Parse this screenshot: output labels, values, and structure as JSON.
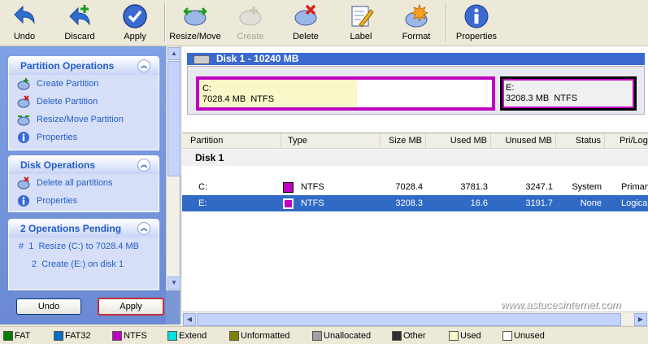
{
  "toolbar": {
    "undo": "Undo",
    "discard": "Discard",
    "apply": "Apply",
    "resize_move": "Resize/Move",
    "create": "Create",
    "delete": "Delete",
    "label": "Label",
    "format": "Format",
    "properties": "Properties"
  },
  "left_panel": {
    "partition_ops": {
      "title": "Partition Operations",
      "items": [
        "Create Partition",
        "Delete Partition",
        "Resize/Move Partition",
        "Properties"
      ]
    },
    "disk_ops": {
      "title": "Disk Operations",
      "items": [
        "Delete all partitions",
        "Properties"
      ]
    },
    "pending": {
      "title": "2 Operations Pending",
      "items": [
        "#  1  Resize (C:) to 7028.4 MB",
        "2  Create (E:) on disk 1"
      ]
    },
    "undo_button": "Undo",
    "apply_button": "Apply"
  },
  "disk": {
    "title": "Disk 1 - 10240 MB",
    "part_c": {
      "name": "C:",
      "info": "7028.4 MB  NTFS",
      "used_fraction": 0.538
    },
    "part_e": {
      "name": "E:",
      "info": "3208.3 MB  NTFS"
    }
  },
  "table": {
    "headers": [
      "Partition",
      "Type",
      "Size MB",
      "Used MB",
      "Unused MB",
      "Status",
      "Pri/Log"
    ],
    "group": "Disk 1",
    "rows": [
      {
        "partition": "C:",
        "type": "NTFS",
        "size": "7028.4",
        "used": "3781.3",
        "unused": "3247.1",
        "status": "System",
        "prilog": "Primary"
      },
      {
        "partition": "E:",
        "type": "NTFS",
        "size": "3208.3",
        "used": "16.6",
        "unused": "3191.7",
        "status": "None",
        "prilog": "Logical"
      }
    ]
  },
  "watermark": "www.astucesinternet.com",
  "legend": [
    {
      "label": "FAT",
      "color": "#008000"
    },
    {
      "label": "FAT32",
      "color": "#0070c0"
    },
    {
      "label": "NTFS",
      "color": "#c000c0"
    },
    {
      "label": "Extend",
      "color": "#00e0e0"
    },
    {
      "label": "Unformatted",
      "color": "#808000"
    },
    {
      "label": "Unallocated",
      "color": "#a0a0a0"
    },
    {
      "label": "Other",
      "color": "#303030"
    },
    {
      "label": "Used",
      "color": "#f8f8c8"
    },
    {
      "label": "Unused",
      "color": "#ffffff"
    }
  ]
}
